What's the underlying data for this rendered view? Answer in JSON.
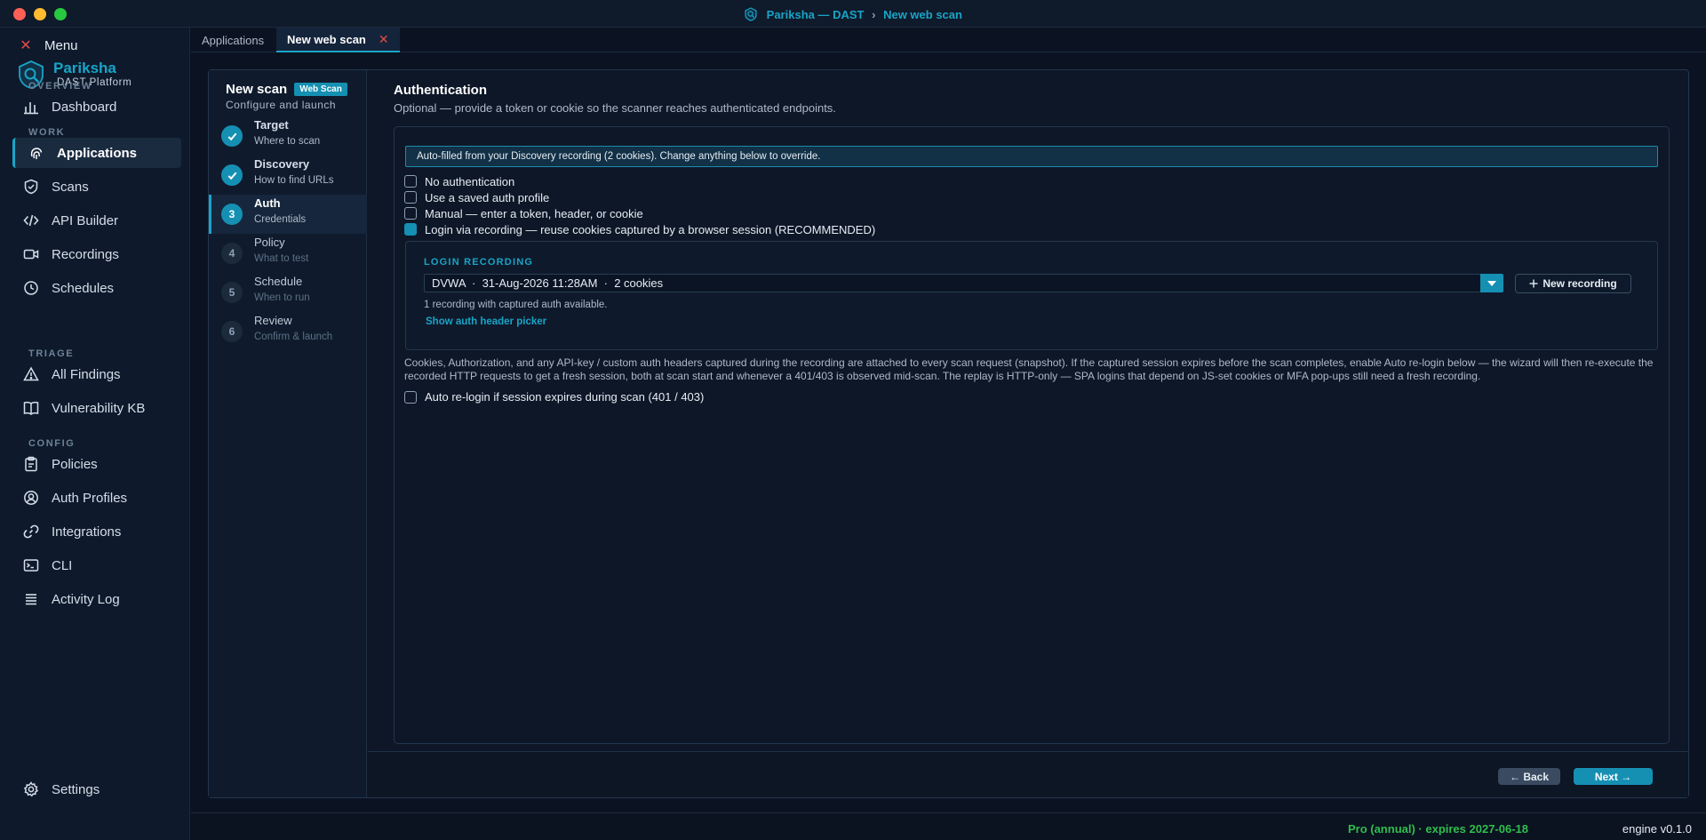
{
  "window": {
    "title_app": "Pariksha — DAST",
    "title_sep": "›",
    "title_page": "New web scan"
  },
  "sidebar": {
    "menu_label": "Menu",
    "brand_name": "Pariksha",
    "brand_sub": "DAST Platform",
    "sections": {
      "overview": "OVERVIEW",
      "work": "WORK",
      "triage": "TRIAGE",
      "config": "CONFIG"
    },
    "items": {
      "dashboard": "Dashboard",
      "applications": "Applications",
      "scans": "Scans",
      "api_builder": "API Builder",
      "recordings": "Recordings",
      "schedules": "Schedules",
      "all_findings": "All Findings",
      "vulnerability_kb": "Vulnerability KB",
      "policies": "Policies",
      "auth_profiles": "Auth Profiles",
      "integrations": "Integrations",
      "cli": "CLI",
      "activity_log": "Activity Log",
      "settings": "Settings"
    }
  },
  "tabs": {
    "applications": "Applications",
    "new_web_scan": "New web scan",
    "close_glyph": "✕"
  },
  "wizard": {
    "title": "New scan",
    "badge": "Web Scan",
    "subtitle": "Configure and launch",
    "steps": [
      {
        "num": "",
        "label": "Target",
        "sub": "Where to scan",
        "state": "done"
      },
      {
        "num": "",
        "label": "Discovery",
        "sub": "How to find URLs",
        "state": "done"
      },
      {
        "num": "3",
        "label": "Auth",
        "sub": "Credentials",
        "state": "current"
      },
      {
        "num": "4",
        "label": "Policy",
        "sub": "What to test",
        "state": "todo"
      },
      {
        "num": "5",
        "label": "Schedule",
        "sub": "When to run",
        "state": "todo"
      },
      {
        "num": "6",
        "label": "Review",
        "sub": "Confirm & launch",
        "state": "todo"
      }
    ]
  },
  "auth": {
    "heading": "Authentication",
    "description": "Optional — provide a token or cookie so the scanner reaches authenticated endpoints.",
    "banner": "Auto-filled from your Discovery recording (2 cookies). Change anything below to override.",
    "options": [
      {
        "label": "No authentication",
        "selected": false
      },
      {
        "label": "Use a saved auth profile",
        "selected": false
      },
      {
        "label": "Manual — enter a token, header, or cookie",
        "selected": false
      },
      {
        "label": "Login via recording — reuse cookies captured by a browser session (RECOMMENDED)",
        "selected": true
      }
    ],
    "recording": {
      "section_label": "LOGIN RECORDING",
      "selected_value": "DVWA  ·  31-Aug-2026 11:28AM  ·  2 cookies",
      "new_button": "New recording",
      "hint": "1 recording with captured auth available.",
      "link": "Show auth header picker"
    },
    "explanation": "Cookies, Authorization, and any API-key / custom auth headers captured during the recording are attached to every scan request (snapshot). If the captured session expires before the scan completes, enable Auto re-login below — the wizard will then re-execute the recorded HTTP requests to get a fresh session, both at scan start and whenever a 401/403 is observed mid-scan. The replay is HTTP-only — SPA logins that depend on JS-set cookies or MFA pop-ups still need a fresh recording.",
    "relogin_label": "Auto re-login if session expires during scan (401 / 403)",
    "relogin_checked": false
  },
  "footer": {
    "back": "← Back",
    "next": "Next →"
  },
  "status": {
    "license": "Pro (annual) · expires 2027-06-18",
    "engine": "engine v0.1.0"
  },
  "colors": {
    "accent": "#1590b3",
    "accent_text": "#19a4c7",
    "license_green": "#2fbe4e",
    "close_red": "#e24b4b"
  }
}
